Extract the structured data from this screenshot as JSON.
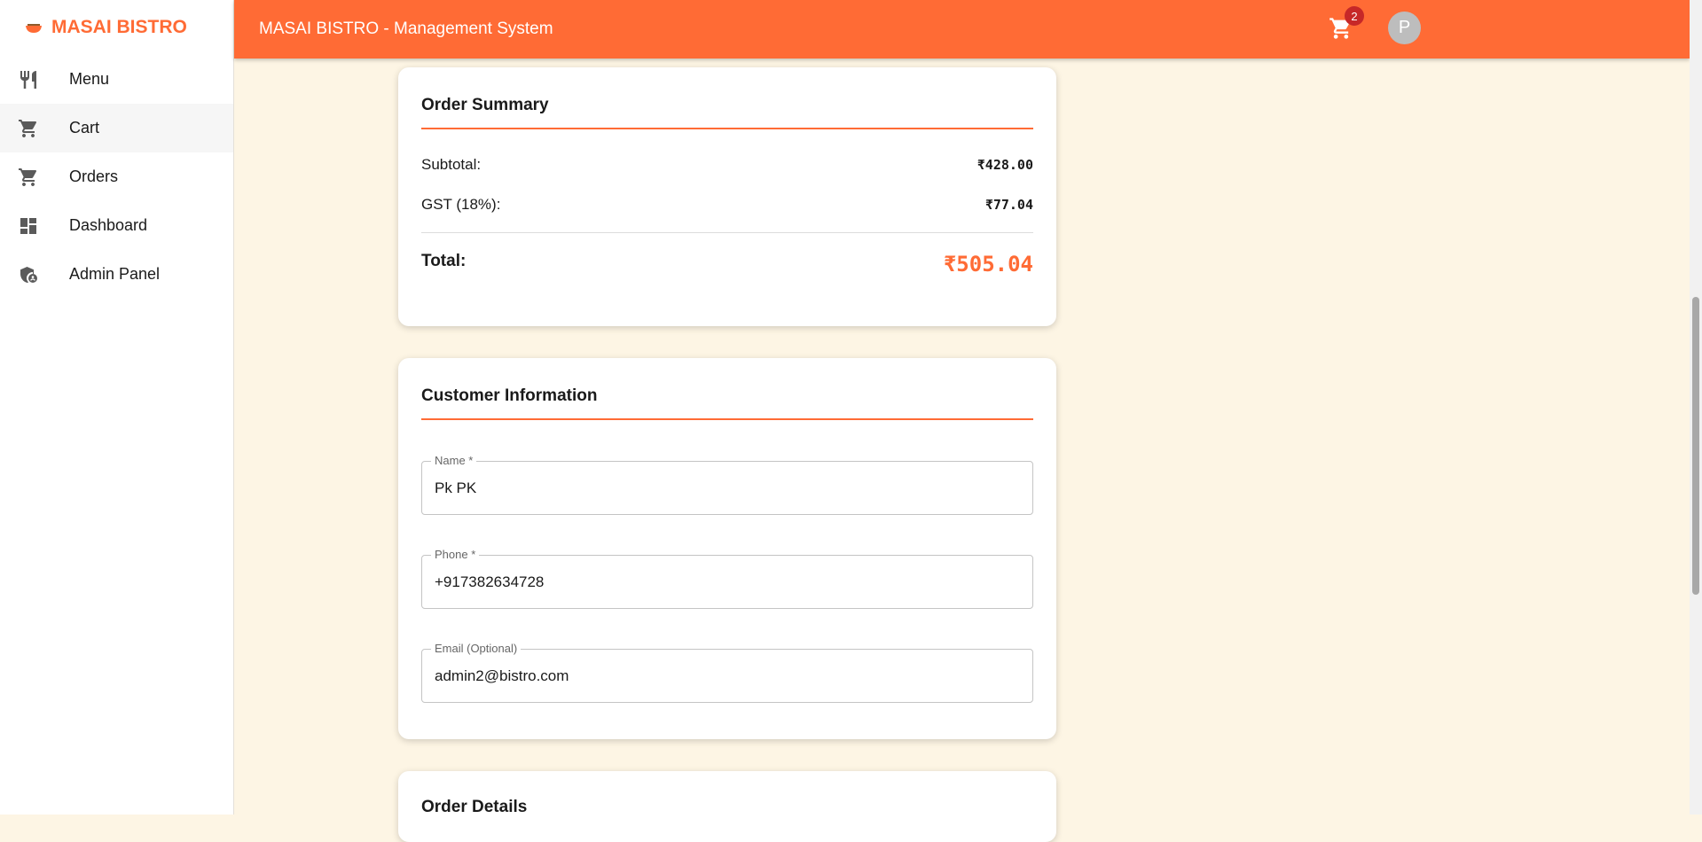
{
  "app": {
    "brand": "MASAI BISTRO",
    "header_title": "MASAI BISTRO - Management System",
    "cart_count": "2",
    "avatar_initial": "P",
    "accent_color": "#ff6b35",
    "background_color": "#fdf5e4"
  },
  "sidebar": {
    "items": [
      {
        "label": "Menu",
        "icon": "restaurant-icon",
        "active": false
      },
      {
        "label": "Cart",
        "icon": "cart-icon",
        "active": true
      },
      {
        "label": "Orders",
        "icon": "cart-icon",
        "active": false
      },
      {
        "label": "Dashboard",
        "icon": "dashboard-icon",
        "active": false
      },
      {
        "label": "Admin Panel",
        "icon": "admin-shield-icon",
        "active": false
      }
    ]
  },
  "order_summary": {
    "title": "Order Summary",
    "subtotal_label": "Subtotal:",
    "subtotal_value": "₹428.00",
    "gst_label": "GST (18%):",
    "gst_value": "₹77.04",
    "total_label": "Total:",
    "total_value": "₹505.04"
  },
  "customer_info": {
    "title": "Customer Information",
    "name_label": "Name *",
    "name_value": "Pk PK",
    "phone_label": "Phone *",
    "phone_value": "+917382634728",
    "email_label": "Email (Optional)",
    "email_value": "admin2@bistro.com"
  },
  "order_details": {
    "title": "Order Details"
  }
}
